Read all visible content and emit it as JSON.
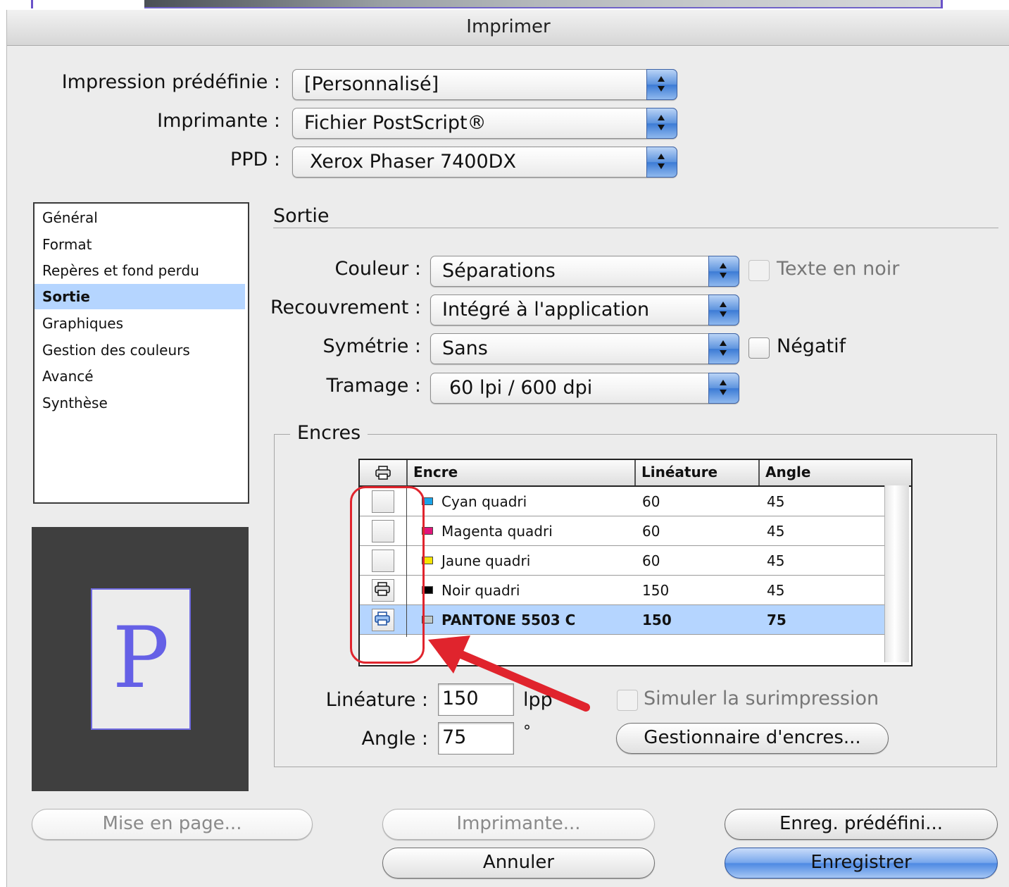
{
  "dialog": {
    "title": "Imprimer"
  },
  "header": {
    "preset": {
      "label": "Impression prédéfinie :",
      "value": "[Personnalisé]"
    },
    "printer": {
      "label": "Imprimante :",
      "value": "Fichier PostScript®"
    },
    "ppd": {
      "label": "PPD :",
      "value": "Xerox Phaser 7400DX"
    }
  },
  "sidebar": {
    "items": [
      {
        "label": "Général"
      },
      {
        "label": "Format"
      },
      {
        "label": "Repères et fond perdu"
      },
      {
        "label": "Sortie",
        "selected": true
      },
      {
        "label": "Graphiques"
      },
      {
        "label": "Gestion des couleurs"
      },
      {
        "label": "Avancé"
      },
      {
        "label": "Synthèse"
      }
    ]
  },
  "preview": {
    "letter": "P"
  },
  "section": {
    "title": "Sortie",
    "color": {
      "label": "Couleur :",
      "value": "Séparations"
    },
    "text_black": {
      "label": "Texte en noir",
      "checked": false
    },
    "trapping": {
      "label": "Recouvrement :",
      "value": "Intégré à l'application"
    },
    "flip": {
      "label": "Symétrie :",
      "value": "Sans"
    },
    "negative": {
      "label": "Négatif",
      "checked": false
    },
    "screening": {
      "label": "Tramage :",
      "value": "60 lpi / 600 dpi"
    }
  },
  "inks": {
    "group_label": "Encres",
    "columns": {
      "print": "printer-icon",
      "ink": "Encre",
      "frequency": "Linéature",
      "angle": "Angle"
    },
    "rows": [
      {
        "name": "Cyan quadri",
        "frequency": "60",
        "angle": "45",
        "printing": false,
        "swatch": "#1aa3e8"
      },
      {
        "name": "Magenta quadri",
        "frequency": "60",
        "angle": "45",
        "printing": false,
        "swatch": "#e0157a"
      },
      {
        "name": "Jaune quadri",
        "frequency": "60",
        "angle": "45",
        "printing": false,
        "swatch": "#f5e400"
      },
      {
        "name": "Noir quadri",
        "frequency": "150",
        "angle": "45",
        "printing": true,
        "swatch": "#000000"
      },
      {
        "name": "PANTONE 5503 C",
        "frequency": "150",
        "angle": "75",
        "printing": true,
        "swatch": "#bfc9c9",
        "selected": true
      }
    ],
    "frequency_field": {
      "label": "Linéature :",
      "value": "150",
      "unit": "lpp"
    },
    "angle_field": {
      "label": "Angle :",
      "value": "75",
      "unit": "°"
    },
    "simulate_overprint": {
      "label": "Simuler la surimpression",
      "checked": false,
      "enabled": false
    },
    "ink_manager_button": "Gestionnaire d'encres..."
  },
  "footer": {
    "page_setup": "Mise en page...",
    "printer_button": "Imprimante...",
    "save_preset": "Enreg. prédéfini...",
    "cancel": "Annuler",
    "save": "Enregistrer"
  },
  "colors": {
    "accent": "#3c7bd5",
    "selection": "#b5d5ff",
    "annotation": "#e0242d"
  }
}
